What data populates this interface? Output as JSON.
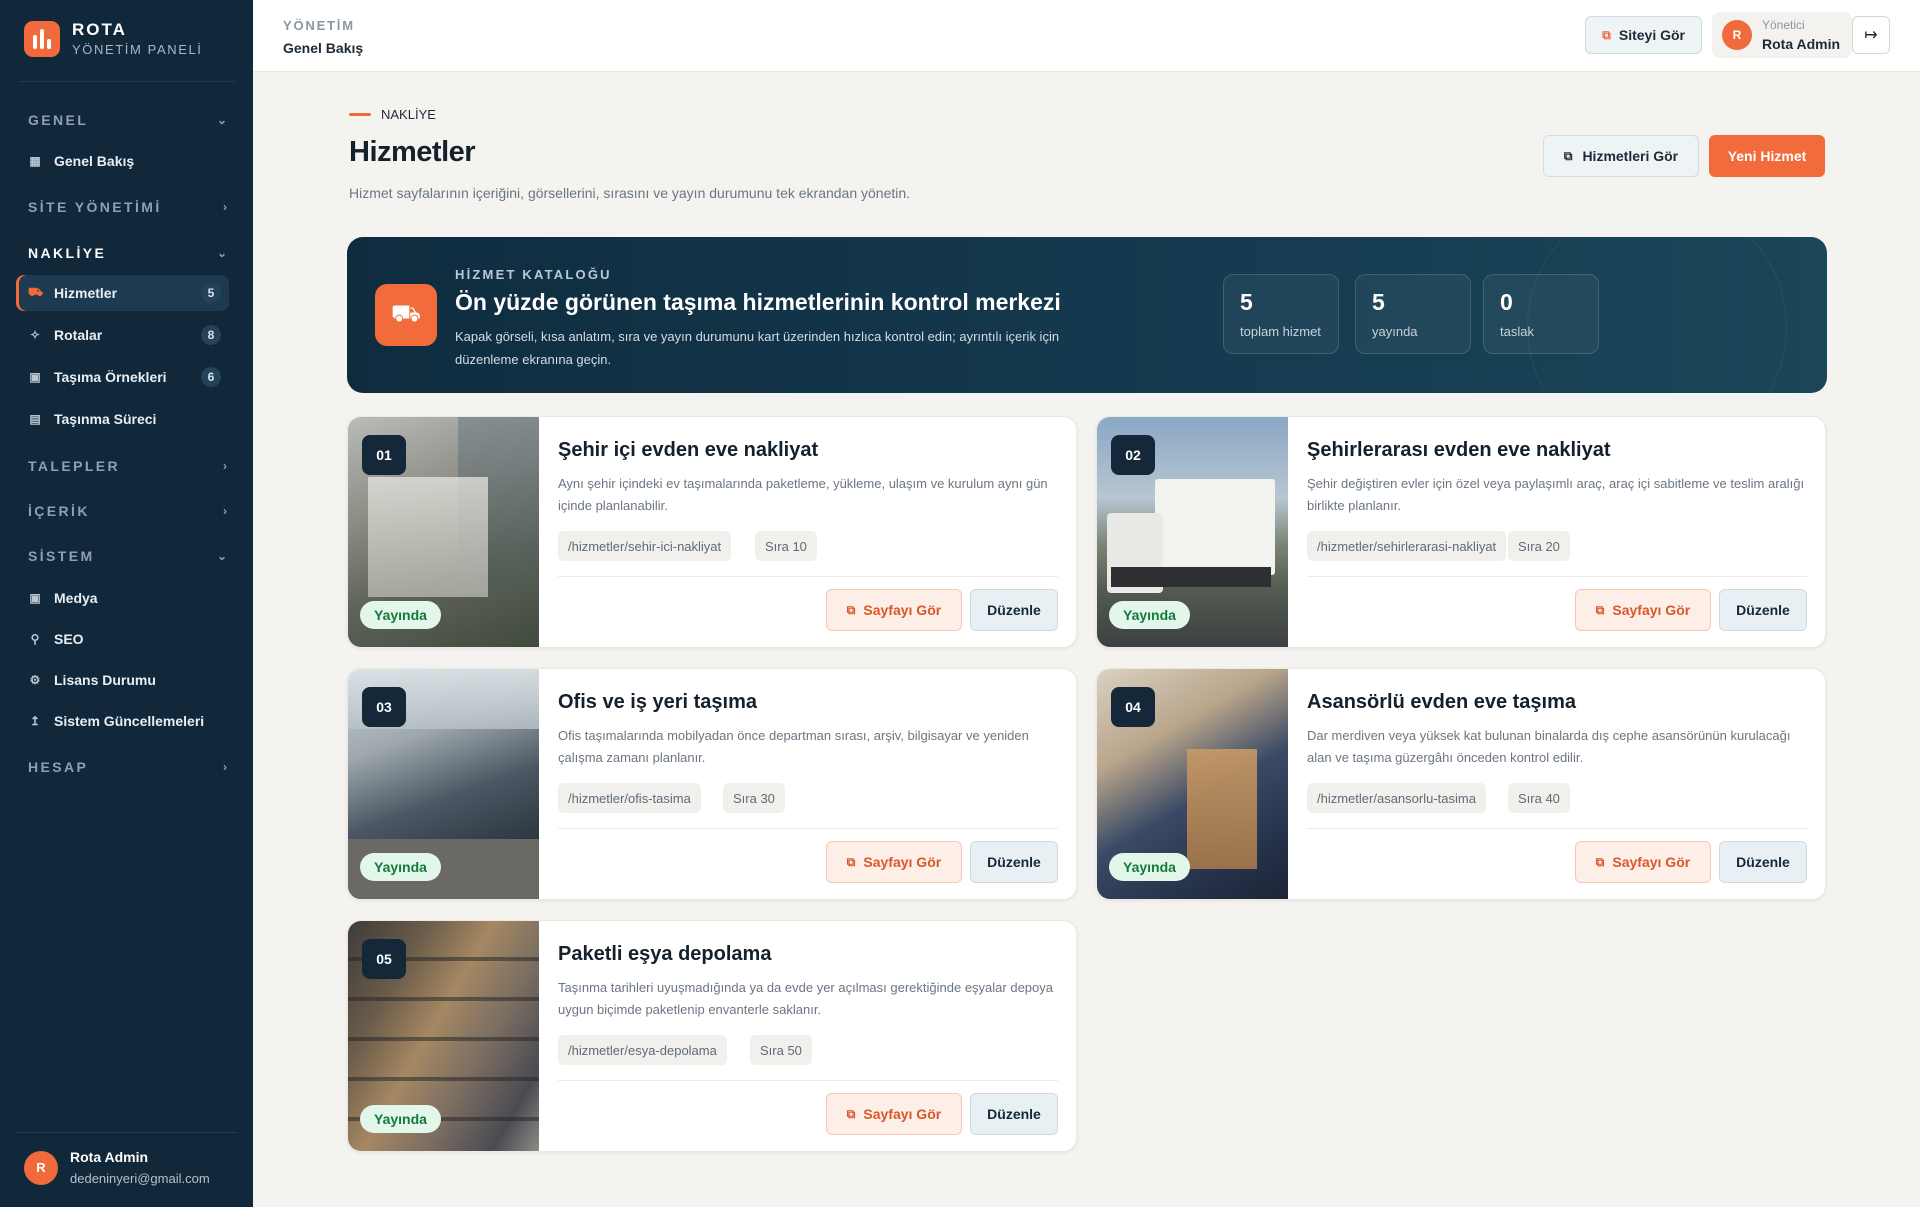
{
  "brand": {
    "name": "ROTA",
    "subtitle": "YÖNETİM PANELİ"
  },
  "sidebar": {
    "sections": [
      {
        "label": "GENEL",
        "expanded": true
      },
      {
        "label": "SİTE YÖNETİMİ",
        "expanded": false
      },
      {
        "label": "NAKLİYE",
        "expanded": true
      },
      {
        "label": "TALEPLER",
        "expanded": false
      },
      {
        "label": "İÇERİK",
        "expanded": false
      },
      {
        "label": "SİSTEM",
        "expanded": true
      },
      {
        "label": "HESAP",
        "expanded": false
      }
    ],
    "items": [
      {
        "label": "Genel Bakış",
        "icon": "grid-icon"
      },
      {
        "label": "Hizmetler",
        "icon": "truck-icon",
        "count": "5",
        "active": true
      },
      {
        "label": "Rotalar",
        "icon": "route-icon",
        "count": "8"
      },
      {
        "label": "Taşıma Örnekleri",
        "icon": "image-icon",
        "count": "6"
      },
      {
        "label": "Taşınma Süreci",
        "icon": "document-icon"
      },
      {
        "label": "Medya",
        "icon": "image-icon"
      },
      {
        "label": "SEO",
        "icon": "search-icon"
      },
      {
        "label": "Lisans Durumu",
        "icon": "gear-icon"
      },
      {
        "label": "Sistem Güncellemeleri",
        "icon": "upload-icon"
      }
    ],
    "user": {
      "initial": "R",
      "name": "Rota Admin",
      "email": "dedeninyeri@gmail.com"
    }
  },
  "topbar": {
    "crumb_top": "YÖNETİM",
    "crumb_main": "Genel Bakış",
    "site_button": "Siteyi Gör",
    "user_role": "Yönetici",
    "user_name": "Rota Admin",
    "user_initial": "R"
  },
  "page": {
    "eyebrow": "NAKLİYE",
    "title": "Hizmetler",
    "description": "Hizmet sayfalarının içeriğini, görsellerini, sırasını ve yayın durumunu tek ekrandan yönetin.",
    "view_services_button": "Hizmetleri Gör",
    "new_service_button": "Yeni Hizmet"
  },
  "hero": {
    "eyebrow": "HİZMET KATALOĞU",
    "title": "Ön yüzde görünen taşıma hizmetlerinin kontrol merkezi",
    "description": "Kapak görseli, kısa anlatım, sıra ve yayın durumunu kart üzerinden hızlıca kontrol edin; ayrıntılı içerik için düzenleme ekranına geçin.",
    "stats": [
      {
        "value": "5",
        "label": "toplam hizmet"
      },
      {
        "value": "5",
        "label": "yayında"
      },
      {
        "value": "0",
        "label": "taslak"
      }
    ]
  },
  "card_labels": {
    "view": "Sayfayı Gör",
    "edit": "Düzenle"
  },
  "services": [
    {
      "num": "01",
      "title": "Şehir içi evden eve nakliyat",
      "description": "Aynı şehir içindeki ev taşımalarında paketleme, yükleme, ulaşım ve kurulum aynı gün içinde planlanabilir.",
      "slug": "/hizmetler/sehir-ici-nakliyat",
      "order": "Sıra 10",
      "status": "Yayında"
    },
    {
      "num": "02",
      "title": "Şehirlerarası evden eve nakliyat",
      "description": "Şehir değiştiren evler için özel veya paylaşımlı araç, araç içi sabitleme ve teslim aralığı birlikte planlanır.",
      "slug": "/hizmetler/sehirlerarasi-nakliyat",
      "order": "Sıra 20",
      "status": "Yayında"
    },
    {
      "num": "03",
      "title": "Ofis ve iş yeri taşıma",
      "description": "Ofis taşımalarında mobilyadan önce departman sırası, arşiv, bilgisayar ve yeniden çalışma zamanı planlanır.",
      "slug": "/hizmetler/ofis-tasima",
      "order": "Sıra 30",
      "status": "Yayında"
    },
    {
      "num": "04",
      "title": "Asansörlü evden eve taşıma",
      "description": "Dar merdiven veya yüksek kat bulunan binalarda dış cephe asansörünün kurulacağı alan ve taşıma güzergâhı önceden kontrol edilir.",
      "slug": "/hizmetler/asansorlu-tasima",
      "order": "Sıra 40",
      "status": "Yayında"
    },
    {
      "num": "05",
      "title": "Paketli eşya depolama",
      "description": "Taşınma tarihleri uyuşmadığında ya da evde yer açılması gerektiğinde eşyalar depoya uygun biçimde paketlenip envanterle saklanır.",
      "slug": "/hizmetler/esya-depolama",
      "order": "Sıra 50",
      "status": "Yayında"
    }
  ],
  "colors": {
    "accent": "#f26b3b",
    "sidebar": "#10283a",
    "hero": "#153b50",
    "published": "#137a3c"
  }
}
